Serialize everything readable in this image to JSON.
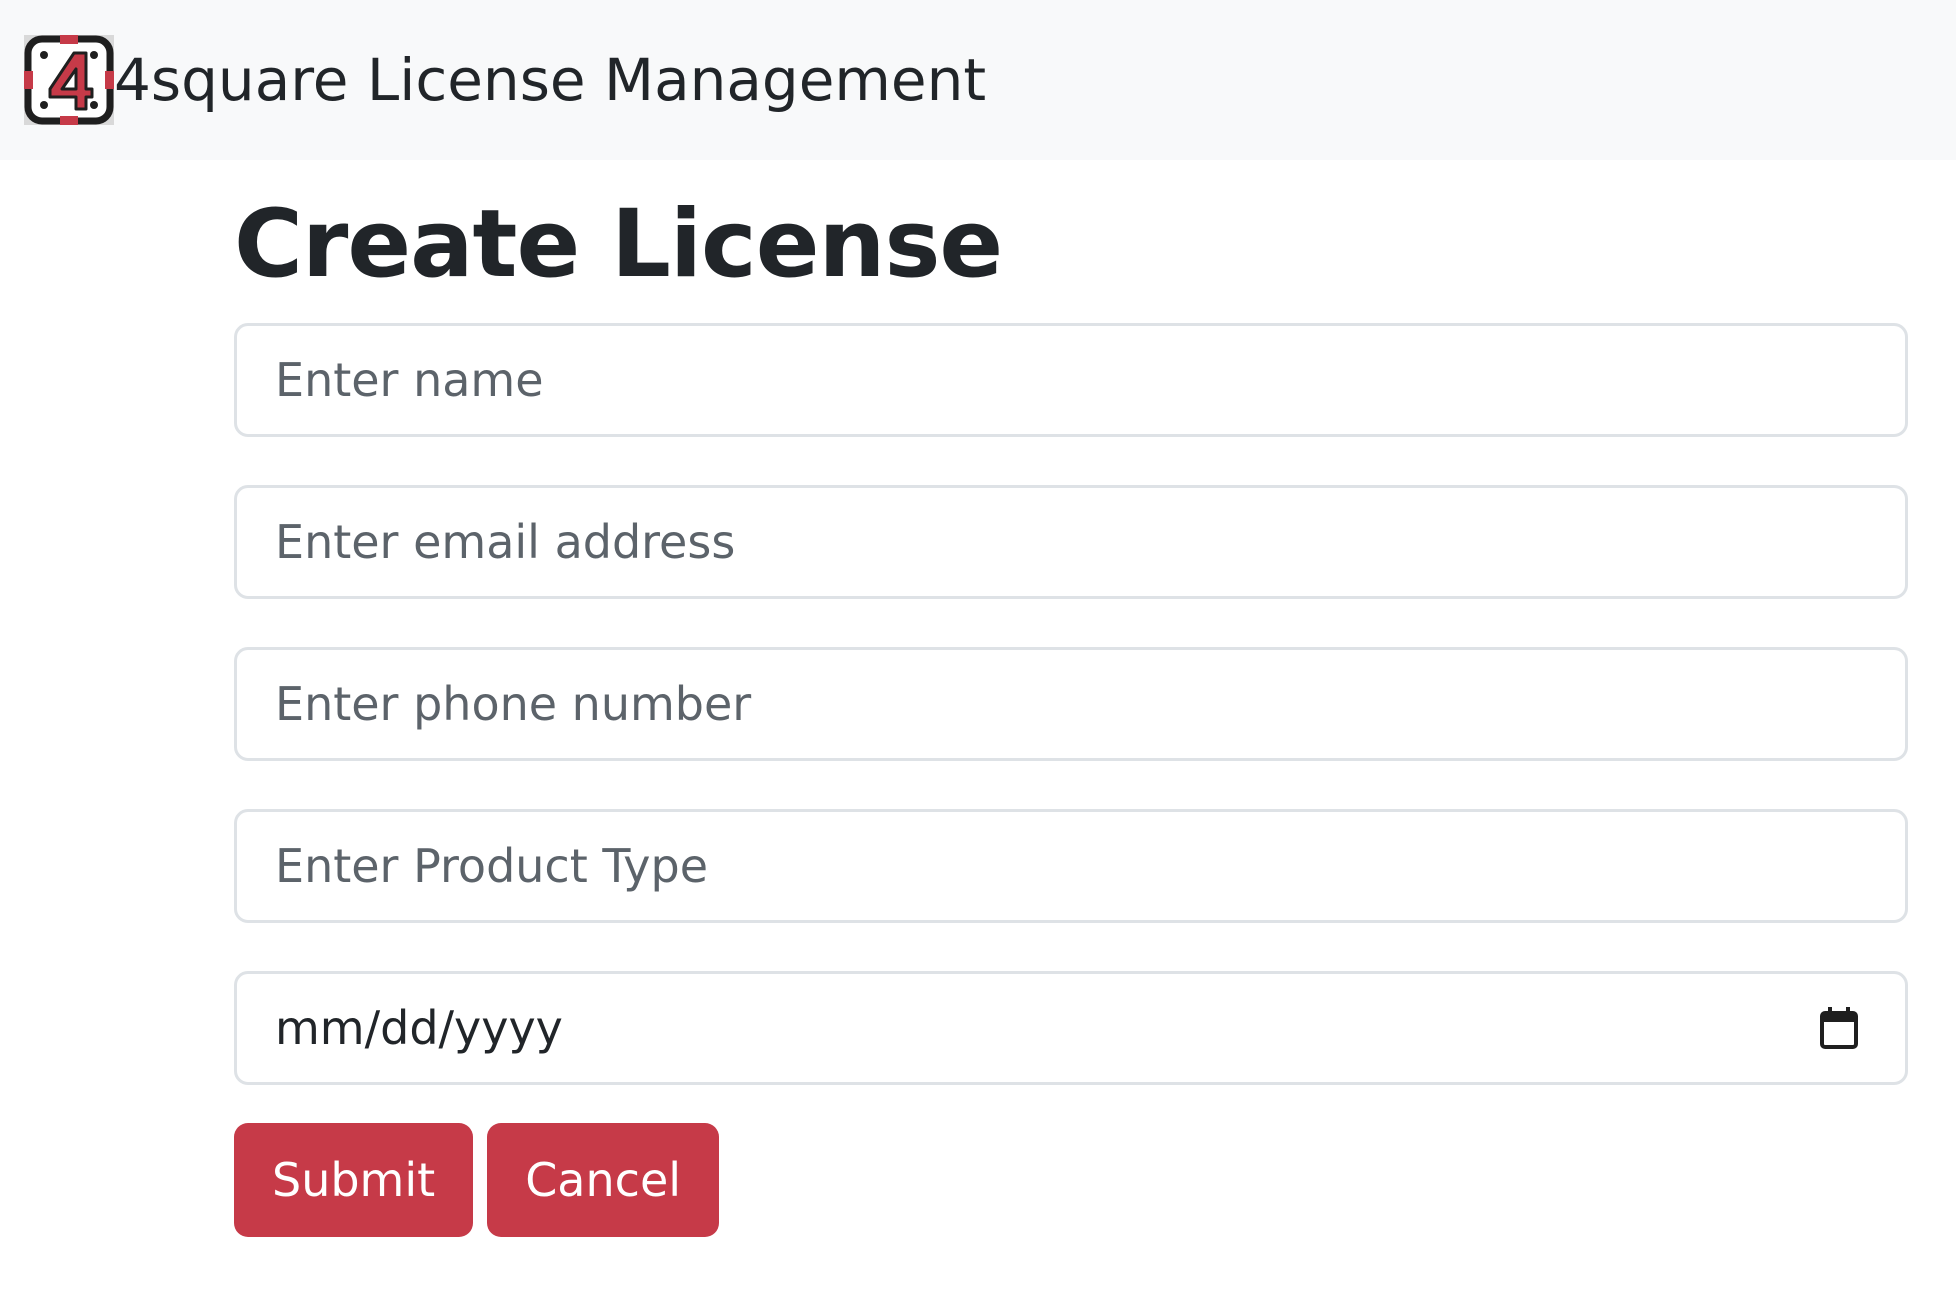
{
  "navbar": {
    "brand_text": "4square License Management",
    "logo_icon": "4square-logo-icon",
    "logo_colors": {
      "frame": "#1f1f1f",
      "accent": "#c63a48"
    }
  },
  "page": {
    "title": "Create License"
  },
  "form": {
    "name_placeholder": "Enter name",
    "email_placeholder": "Enter email address",
    "phone_placeholder": "Enter phone number",
    "product_type_placeholder": "Enter Product Type",
    "date_value": "mm/dd/yyyy",
    "date_icon": "calendar-icon"
  },
  "actions": {
    "submit_label": "Submit",
    "cancel_label": "Cancel",
    "button_color": "#c63a48"
  }
}
